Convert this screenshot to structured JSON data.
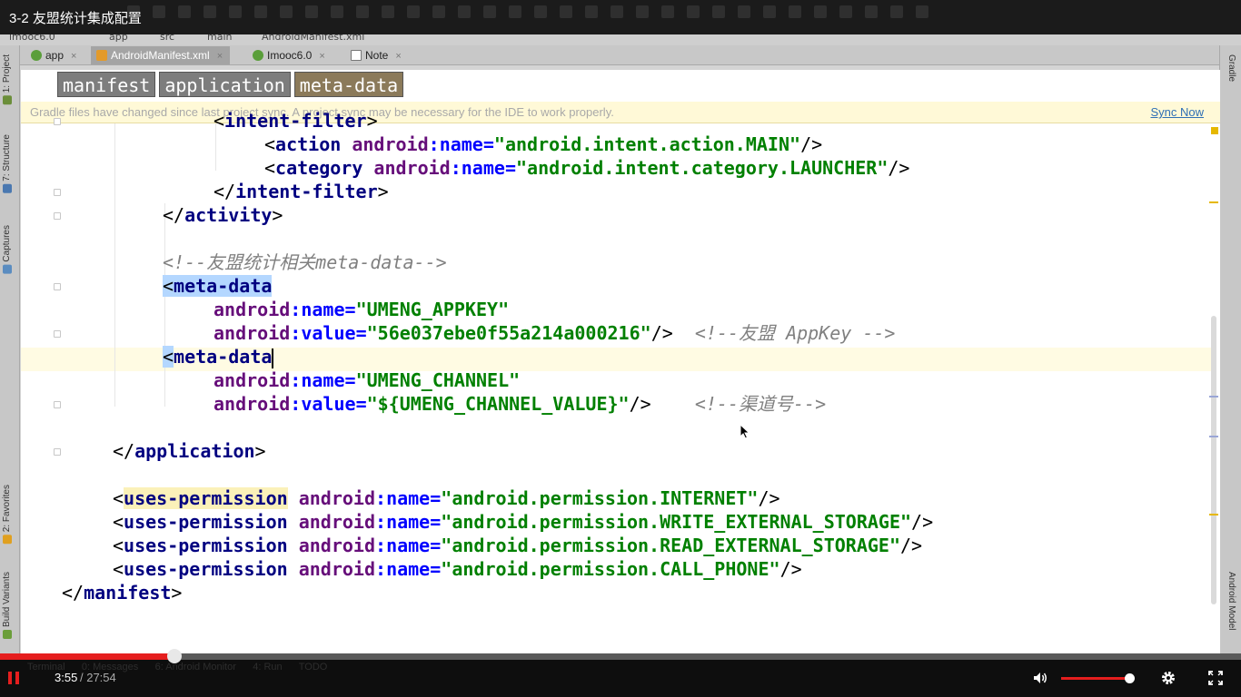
{
  "video": {
    "title": "3-2 友盟统计集成配置",
    "current_time": "3:55",
    "total_time": "/ 27:54",
    "progress": 0.1405,
    "volume": 0.99
  },
  "ide": {
    "breadcrumbs": [
      "imooc6.0",
      "app",
      "src",
      "main",
      "AndroidManifest.xml"
    ],
    "tabs": [
      {
        "label": "app",
        "close": "×",
        "active": false
      },
      {
        "label": "AndroidManifest.xml",
        "close": "×",
        "active": true
      },
      {
        "label": "Imooc6.0",
        "close": "×",
        "active": false
      },
      {
        "label": "Note",
        "close": "×",
        "active": false
      }
    ],
    "left_tools": [
      "1: Project",
      "7: Structure",
      "Captures",
      "2: Favorites",
      "Build Variants"
    ],
    "right_tools": [
      "Gradle",
      "Android Model"
    ],
    "xml_crumbs": [
      "manifest",
      "application",
      "meta-data"
    ],
    "gradle_banner": {
      "message": "Gradle files have changed since last project sync. A project sync may be necessary for the IDE to work properly.",
      "action": "Sync Now"
    },
    "code": {
      "l1": "intent-filter",
      "l2_tag": "action",
      "l2_attr_ns": "android",
      "l2_attr": "name",
      "l2_val": "\"android.intent.action.MAIN\"",
      "l3_tag": "category",
      "l3_attr_ns": "android",
      "l3_attr": "name",
      "l3_val": "\"android.intent.category.LAUNCHER\"",
      "l4": "intent-filter",
      "l5": "activity",
      "l7": "<!--友盟统计相关meta-data-->",
      "l8": "meta-data",
      "l9_ns": "android",
      "l9_attr": "name",
      "l9_val": "\"UMENG_APPKEY\"",
      "l10_ns": "android",
      "l10_attr": "value",
      "l10_val": "\"56e037ebe0f55a214a000216\"",
      "l10_comment": "<!--友盟 AppKey -->",
      "l11": "meta-data",
      "l12_ns": "android",
      "l12_attr": "name",
      "l12_val": "\"UMENG_CHANNEL\"",
      "l13_ns": "android",
      "l13_attr": "value",
      "l13_val": "\"${UMENG_CHANNEL_VALUE}\"",
      "l13_comment": "<!--渠道号-->",
      "l15": "application",
      "perm_tag": "uses-permission",
      "perm_ns": "android",
      "perm_attr": "name",
      "perms": [
        "\"android.permission.INTERNET\"",
        "\"android.permission.WRITE_EXTERNAL_STORAGE\"",
        "\"android.permission.READ_EXTERNAL_STORAGE\"",
        "\"android.permission.CALL_PHONE\""
      ],
      "l21": "manifest"
    }
  }
}
